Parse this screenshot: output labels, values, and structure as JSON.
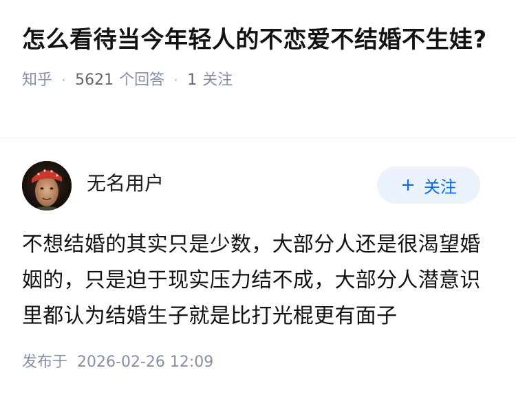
{
  "question": {
    "title": "怎么看待当今年轻人的不恋爱不结婚不生娃?",
    "source": "知乎",
    "separator": "·",
    "answer_count": "5621",
    "answer_label": "个回答",
    "follower_count": "1",
    "follower_label": "关注"
  },
  "answer": {
    "author_name": "无名用户",
    "follow_label": "关注",
    "content": "不想结婚的其实只是少数，大部分人还是很渴望婚姻的，只是迫于现实压力结不成，大部分人潜意识里都认为结婚生子就是比打光棍更有面子",
    "publish_prefix": "发布于",
    "publish_time": "2026-02-26 12:09"
  },
  "colors": {
    "meta_gray": "#8590a6",
    "follow_blue": "#056de8",
    "follow_bg": "#ebf2fc"
  },
  "icons": {
    "follow": "plus-icon",
    "avatar": "user-avatar-photo"
  }
}
